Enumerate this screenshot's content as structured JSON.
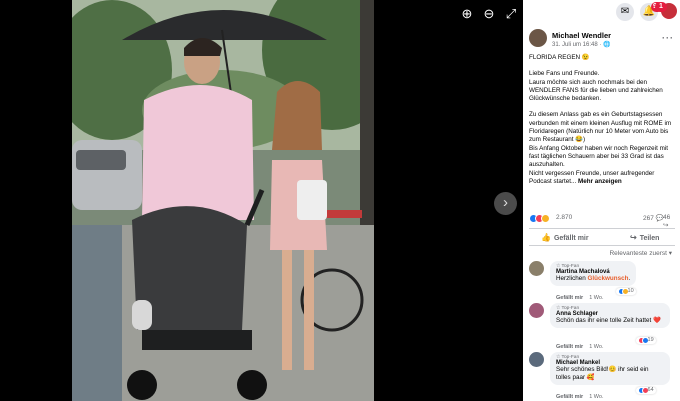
{
  "viewer": {
    "zoom_in_icon": "zoom-in-icon",
    "zoom_out_icon": "zoom-out-icon",
    "fullscreen_icon": "fullscreen-icon",
    "next_icon": "chevron-right-icon"
  },
  "top_icons": {
    "notifications_badge": "9+",
    "profile_badge": "1"
  },
  "post": {
    "author": "Michael Wendler",
    "meta": "31. Juli um 16:48 · ",
    "paragraphs": [
      "FLORIDA REGEN 😉",
      "Liebe Fans und Freunde.\nLaura möchte sich auch nochmals bei den WENDLER FANS für die lieben und zahlreichen Glückwünsche bedanken.",
      "Zu diesem Anlass gab es ein Geburtstagsessen verbunden mit einem kleinen Ausflug mit ROME im Floridaregen (Natürlich nur 10 Meter vom Auto bis zum Restaurant 😂)\nBis Anfang Oktober haben wir noch Regenzeit mit fast täglichen Schauern aber bei 33 Grad ist das auszuhalten.\nNicht vergessen Freunde, unser aufregender Podcast startet..."
    ],
    "see_more": "Mehr anzeigen",
    "reaction_count": "2.870",
    "comment_count": "267",
    "share_count": "46",
    "like_label": "Gefällt mir",
    "share_label": "Teilen",
    "sort_label": "Relevanteste zuerst ▾"
  },
  "comments": [
    {
      "badge": "Top-Fan",
      "author": "Martina Machalová",
      "text_prefix": "Herzlichen ",
      "text_highlight": "Glückwunsch",
      "text_suffix": ".",
      "like": "Gefällt mir",
      "age": "1 Wo.",
      "reactions": "10",
      "avatar_color": "#8a7f6a"
    },
    {
      "badge": "Top-Fan",
      "author": "Anna Schlager",
      "text": "Schön das ihr eine tolle Zeit hattet ❤️",
      "like": "Gefällt mir",
      "age": "1 Wo.",
      "reactions": "19",
      "avatar_color": "#a05a78"
    },
    {
      "badge": "Top-Fan",
      "author": "Michael Mankel",
      "text": "Sehr schönes Bild!😊 ihr seid ein tolles paar 🥰",
      "like": "Gefällt mir",
      "age": "1 Wo.",
      "reactions": "64",
      "avatar_color": "#5b6a7c"
    }
  ],
  "colors": {
    "facebook_blue": "#1877f2",
    "love_red": "#f33e58",
    "haha_yellow": "#f7b125"
  }
}
